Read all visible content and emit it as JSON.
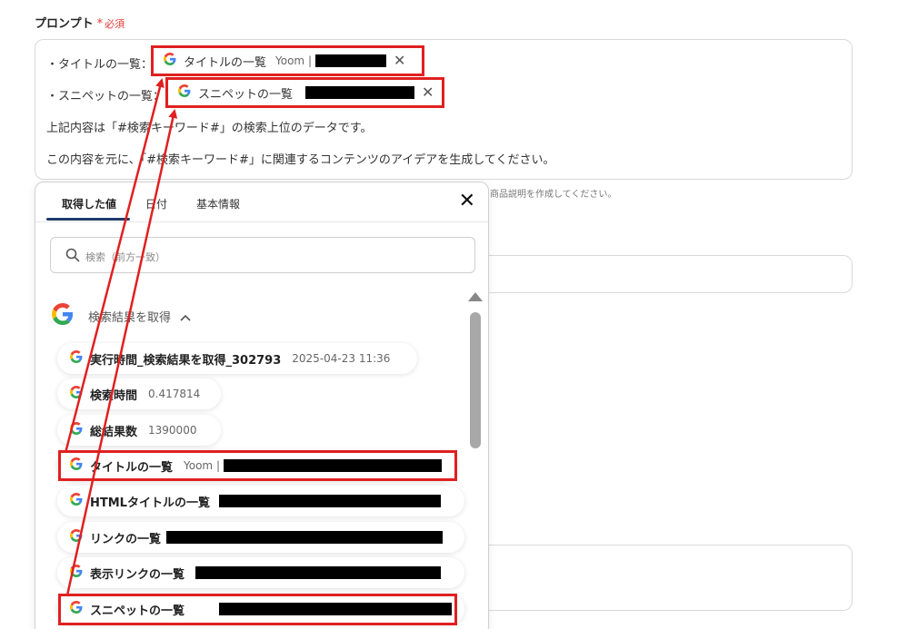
{
  "prompt_field": {
    "label": "プロンプト",
    "required_star": "*",
    "required_text": "必須",
    "line_titles_label": "・タイトルの一覧：",
    "line_snippets_label": "・スニペットの一覧：",
    "line3": "上記内容は「#検索キーワード#」の検索上位のデータです。",
    "line4": "この内容を元に、「#検索キーワード#」に関連するコンテンツのアイデアを生成してください。",
    "chip_titles": {
      "label": "タイトルの一覧",
      "sub": "Yoom |"
    },
    "chip_snippets": {
      "label": "スニペットの一覧"
    }
  },
  "hint_text": "商品説明を作成してください。",
  "panel": {
    "tabs": [
      "取得した値",
      "日付",
      "基本情報"
    ],
    "active_tab": 0,
    "search_placeholder": "検索（前方一致）",
    "group_label": "検索結果を取得",
    "items": [
      {
        "label": "実行時間_検索結果を取得_302793",
        "value": "2025-04-23 11:36"
      },
      {
        "label": "検索時間",
        "value": "0.417814"
      },
      {
        "label": "総結果数",
        "value": "1390000"
      },
      {
        "label": "タイトルの一覧",
        "value": "Yoom |"
      },
      {
        "label": "HTMLタイトルの一覧",
        "value": ""
      },
      {
        "label": "リンクの一覧",
        "value": ""
      },
      {
        "label": "表示リンクの一覧",
        "value": ""
      },
      {
        "label": "スニペットの一覧",
        "value": ""
      }
    ]
  },
  "colors": {
    "highlight": "#e02020",
    "tab_underline": "#1f3b6b"
  },
  "icons": [
    "google-icon",
    "close-icon",
    "search-icon",
    "chevron-up-icon"
  ]
}
